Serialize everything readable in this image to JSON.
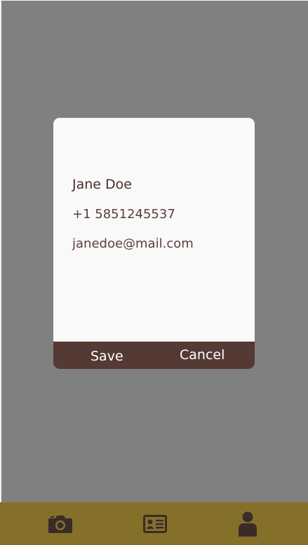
{
  "dialog": {
    "name": "Jane Doe",
    "phone": "+1 5851245537",
    "email": "janedoe@mail.com",
    "save_label": "Save",
    "cancel_label": "Cancel"
  },
  "bottom_nav": {
    "items": [
      {
        "icon": "camera-icon"
      },
      {
        "icon": "contact-card-icon"
      },
      {
        "icon": "person-icon"
      }
    ]
  },
  "colors": {
    "overlay": "#808080",
    "dialog_bg": "#f9f9f9",
    "action_bar": "#553a34",
    "nav_bar": "#85702a",
    "icon_fill": "#3b2b28",
    "text_primary": "#4a302c"
  }
}
